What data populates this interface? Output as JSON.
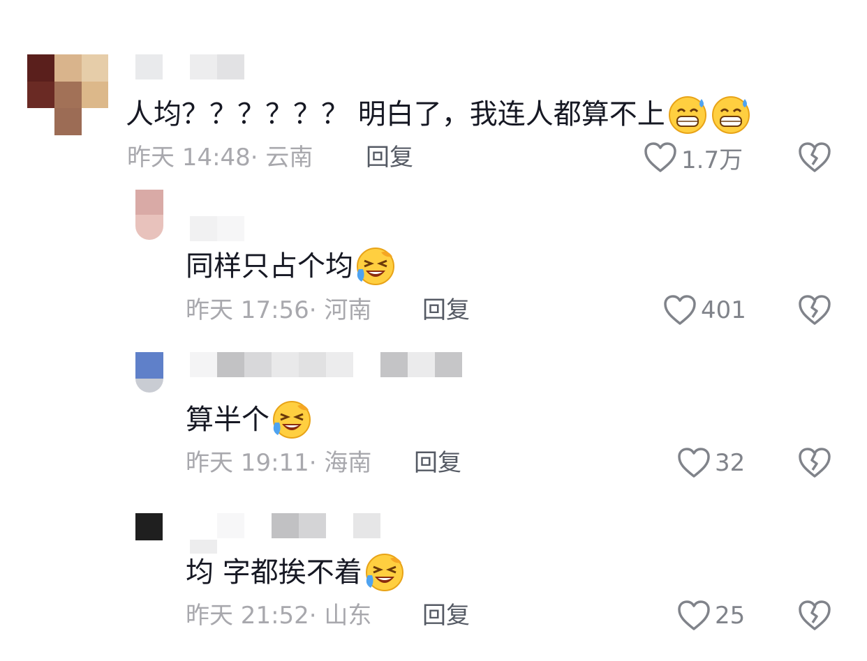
{
  "comments": [
    {
      "text": "人均？？？？？？ 明白了，我连人都算不上",
      "emojis": [
        "grin-sweat-emoji",
        "grin-sweat-emoji"
      ],
      "time": "昨天 14:48",
      "location": "云南",
      "reply_label": "回复",
      "likes": "1.7万"
    },
    {
      "text": "同样只占个均",
      "emojis": [
        "laugh-cry-emoji"
      ],
      "time": "昨天 17:56",
      "location": "河南",
      "reply_label": "回复",
      "likes": "401"
    },
    {
      "text": "算半个",
      "emojis": [
        "laugh-cry-emoji"
      ],
      "time": "昨天 19:11",
      "location": "海南",
      "reply_label": "回复",
      "likes": "32"
    },
    {
      "text": "均 字都挨不着",
      "emojis": [
        "laugh-cry-emoji"
      ],
      "time": "昨天 21:52",
      "location": "山东",
      "reply_label": "回复",
      "likes": "25"
    }
  ],
  "icons": {
    "like": "heart-outline-icon",
    "dislike": "broken-heart-icon"
  },
  "colors": {
    "text": "#161823",
    "meta": "#a8a8ad",
    "reply": "#555a64",
    "icon": "#80838a"
  }
}
